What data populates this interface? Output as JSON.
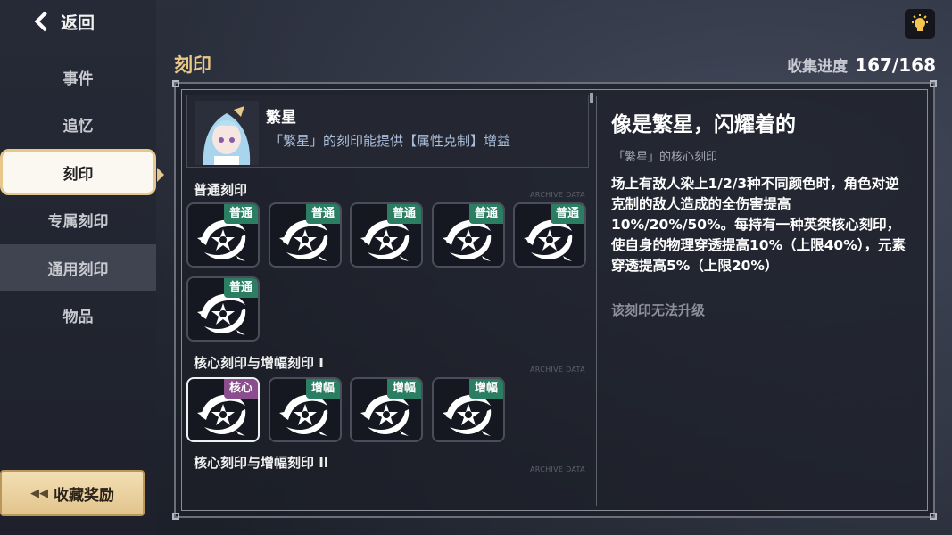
{
  "nav": {
    "back_label": "返回",
    "items": [
      {
        "label": "事件"
      },
      {
        "label": "追忆"
      },
      {
        "label": "刻印"
      },
      {
        "label": "专属刻印"
      },
      {
        "label": "通用刻印"
      },
      {
        "label": "物品"
      }
    ],
    "reward_label": "收藏奖励"
  },
  "header": {
    "section_title": "刻印",
    "progress_label": "收集进度",
    "progress_value": "167/168"
  },
  "hero": {
    "name": "繁星",
    "desc": "「繁星」的刻印能提供【属性克制】增益"
  },
  "groups": [
    {
      "title": "普通刻印",
      "archive": "ARCHIVE DATA"
    },
    {
      "title": "核心刻印与增幅刻印 I",
      "archive": "ARCHIVE DATA"
    },
    {
      "title": "核心刻印与增幅刻印 II",
      "archive": "ARCHIVE DATA"
    }
  ],
  "slots": {
    "normal": [
      "普通",
      "普通",
      "普通",
      "普通",
      "普通",
      "普通"
    ],
    "core1": [
      "核心",
      "增幅",
      "增幅",
      "增幅"
    ]
  },
  "detail": {
    "title": "像是繁星，闪耀着的",
    "subtitle": "「繁星」的核心刻印",
    "body": "场上有敌人染上1/2/3种不同颜色时，角色对逆克制的敌人造成的全伤害提高10%/20%/50%。每持有一种英桀核心刻印，使自身的物理穿透提高10%（上限40%），元素穿透提高5%（上限20%）",
    "note": "该刻印无法升级"
  },
  "colors": {
    "accent": "#e9c788",
    "tag_normal": "#2c7e62",
    "tag_core": "#8a4d8e"
  },
  "icons": {
    "back": "chevron-left-icon",
    "bulb": "lightbulb-icon",
    "reward": "double-chevron-left-icon",
    "emblem": "star-emblem-icon"
  }
}
